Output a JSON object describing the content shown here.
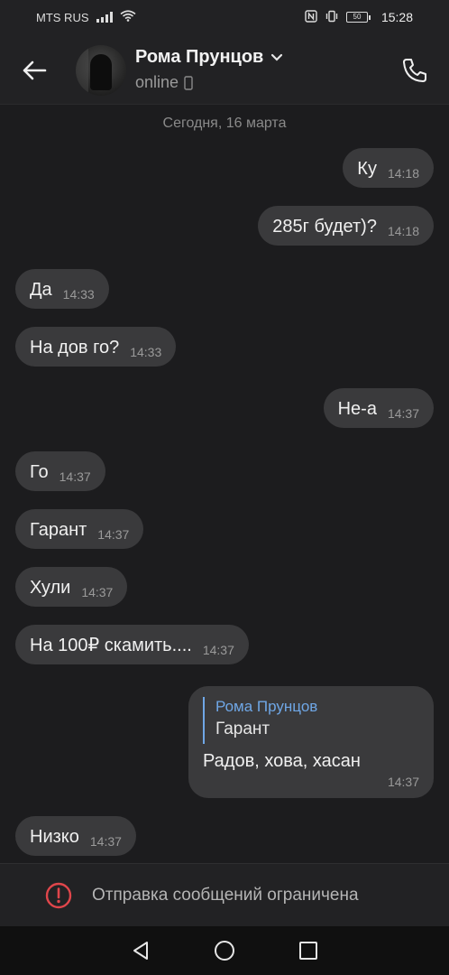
{
  "status_bar": {
    "carrier": "MTS RUS",
    "battery": "50",
    "time": "15:28"
  },
  "header": {
    "contact_name": "Рома Прунцов",
    "status": "online",
    "icons": [
      "back-arrow-icon",
      "chevron-down-icon",
      "phone-icon",
      "mobile-device-icon"
    ]
  },
  "chat": {
    "date_separator": "Сегодня, 16 марта",
    "messages": [
      {
        "direction": "out",
        "text": "Ку",
        "time": "14:18"
      },
      {
        "direction": "out",
        "text": "285г будет)?",
        "time": "14:18"
      },
      {
        "direction": "in",
        "text": "Да",
        "time": "14:33"
      },
      {
        "direction": "in",
        "text": "На дов го?",
        "time": "14:33"
      },
      {
        "direction": "out",
        "text": "Не-а",
        "time": "14:37"
      },
      {
        "direction": "in",
        "text": "Го",
        "time": "14:37"
      },
      {
        "direction": "in",
        "text": "Гарант",
        "time": "14:37"
      },
      {
        "direction": "in",
        "text": "Хули",
        "time": "14:37"
      },
      {
        "direction": "in",
        "text": "На 100₽ скамить....",
        "time": "14:37"
      },
      {
        "direction": "out",
        "reply_author": "Рома Прунцов",
        "reply_quote": "Гарант",
        "text": "Радов, хова, хасан",
        "time": "14:37"
      },
      {
        "direction": "in",
        "text": "Низко",
        "time": "14:37"
      }
    ]
  },
  "restriction": {
    "text": "Отправка сообщений ограничена",
    "icon": "alert-circle-icon",
    "color": "#e0464b"
  },
  "navbar": {
    "icons": [
      "back-triangle-icon",
      "home-circle-icon",
      "recents-square-icon"
    ]
  },
  "colors": {
    "background": "#1c1c1e",
    "bubble": "#3a3a3c",
    "reply_accent": "#6fa7e6"
  }
}
